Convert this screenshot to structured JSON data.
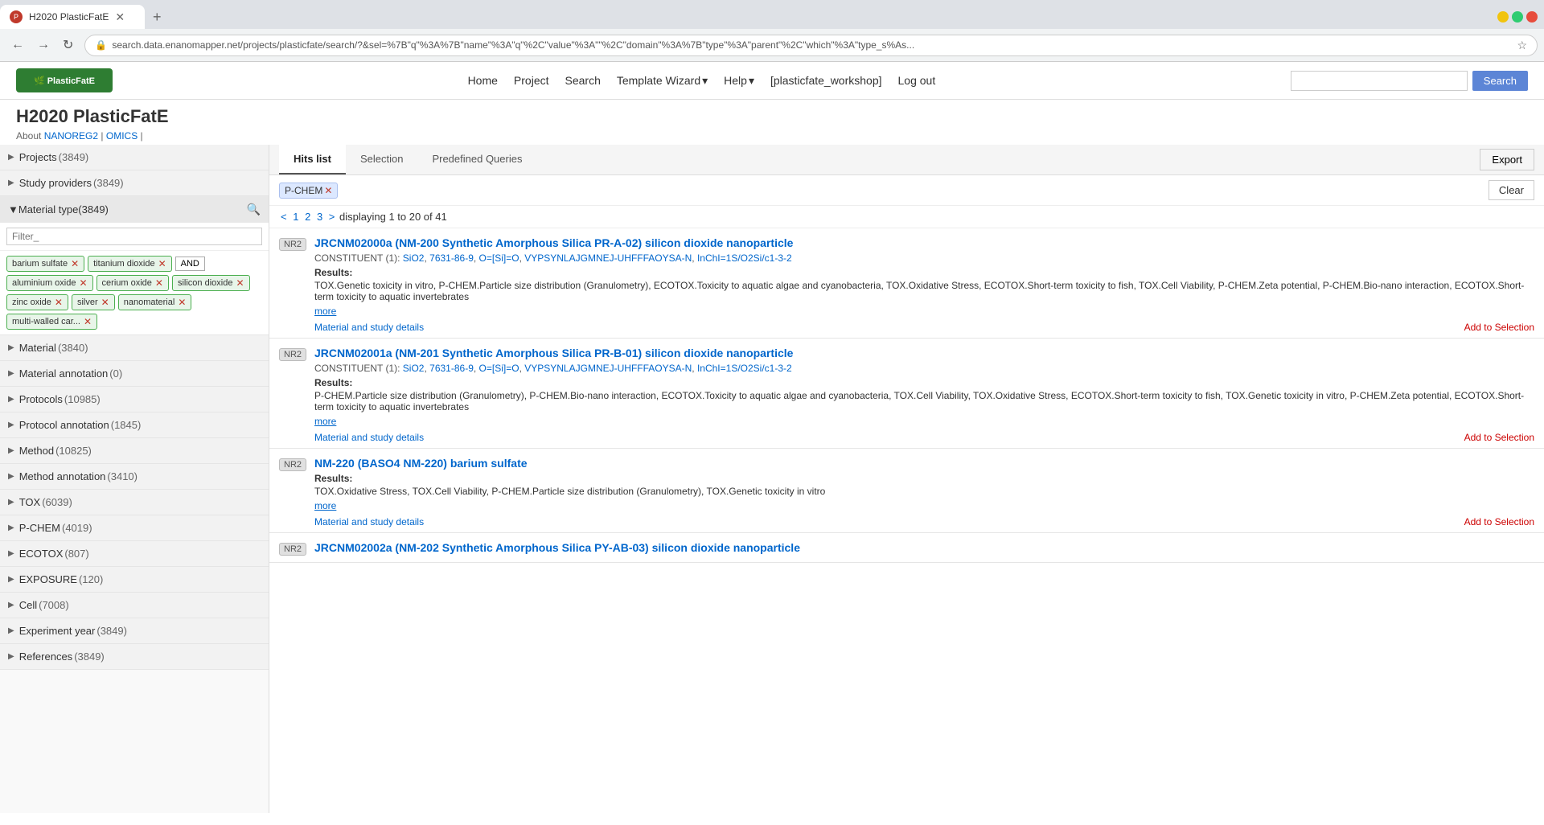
{
  "browser": {
    "tab_title": "H2020 PlasticFatE",
    "url": "search.data.enanomapper.net/projects/plasticfate/search/?&sel=%7B\"q\"%3A%7B\"name\"%3A\"q\"%2C\"value\"%3A\"\"%2C\"domain\"%3A%7B\"type\"%3A\"parent\"%2C\"which\"%3A\"type_s%As...",
    "new_tab": "+",
    "nav_back": "←",
    "nav_forward": "→",
    "nav_refresh": "↻"
  },
  "app": {
    "logo_text": "PlasticFatE",
    "title": "H2020 PlasticFatE",
    "nav": {
      "home": "Home",
      "project": "Project",
      "search": "Search",
      "template_wizard": "Template Wizard",
      "help": "Help",
      "workshop": "[plasticfate_workshop]",
      "logout": "Log out"
    },
    "search_placeholder": "",
    "search_btn": "Search",
    "about_label": "About",
    "nanoreg2": "NANOREG2",
    "omics": "OMICS"
  },
  "tabs": {
    "hits_list": "Hits list",
    "selection": "Selection",
    "predefined_queries": "Predefined Queries",
    "export": "Export"
  },
  "filters": {
    "pchem_tag": "P-CHEM",
    "clear_btn": "Clear"
  },
  "pagination": {
    "text": "< 1 2 3 > displaying 1 to 20 of 41",
    "pages": [
      "1",
      "2",
      "3"
    ]
  },
  "sidebar": {
    "items": [
      {
        "label": "Projects",
        "count": "(3849)",
        "expanded": false
      },
      {
        "label": "Study providers",
        "count": "(3849)",
        "expanded": false
      },
      {
        "label": "Material type",
        "count": "(3849)",
        "expanded": true
      },
      {
        "label": "Material",
        "count": "(3840)",
        "expanded": false
      },
      {
        "label": "Material annotation",
        "count": "(0)",
        "expanded": false
      },
      {
        "label": "Protocols",
        "count": "(10985)",
        "expanded": false
      },
      {
        "label": "Protocol annotation",
        "count": "(1845)",
        "expanded": false
      },
      {
        "label": "Method",
        "count": "(10825)",
        "expanded": false
      },
      {
        "label": "Method annotation",
        "count": "(3410)",
        "expanded": false
      },
      {
        "label": "TOX",
        "count": "(6039)",
        "expanded": false
      },
      {
        "label": "P-CHEM",
        "count": "(4019)",
        "expanded": false
      },
      {
        "label": "ECOTOX",
        "count": "(807)",
        "expanded": false
      },
      {
        "label": "EXPOSURE",
        "count": "(120)",
        "expanded": false
      },
      {
        "label": "Cell",
        "count": "(7008)",
        "expanded": false
      },
      {
        "label": "Experiment year",
        "count": "(3849)",
        "expanded": false
      },
      {
        "label": "References",
        "count": "(3849)",
        "expanded": false
      }
    ],
    "filter_placeholder": "Filter_",
    "tags": [
      "barium sulfate",
      "titanium dioxide",
      "aluminium oxide",
      "cerium oxide",
      "silicon dioxide",
      "zinc oxide",
      "silver",
      "nanomaterial",
      "multi-walled car..."
    ],
    "and_btn": "AND"
  },
  "results": [
    {
      "nr": "NR2",
      "title": "JRCNM02000a (NM-200 Synthetic Amorphous Silica PR-A-02) silicon dioxide nanoparticle",
      "constituent": "CONSTITUENT (1): SiO2, 7631-86-9, O=[Si]=O, VYPSYNLAJGMNEJ-UHFFFAOYSA-N, InChI=1S/O2Si/c1-3-2",
      "results_label": "Results:",
      "results_text": "TOX.Genetic toxicity in vitro, P-CHEM.Particle size distribution (Granulometry), ECOTOX.Toxicity to aquatic algae and cyanobacteria, TOX.Oxidative Stress, ECOTOX.Short-term toxicity to fish, TOX.Cell Viability, P-CHEM.Zeta potential, P-CHEM.Bio-nano interaction, ECOTOX.Short-term toxicity to aquatic invertebrates",
      "more": "more",
      "study_link": "Material and study details",
      "add_selection": "Add to Selection"
    },
    {
      "nr": "NR2",
      "title": "JRCNM02001a (NM-201 Synthetic Amorphous Silica PR-B-01) silicon dioxide nanoparticle",
      "constituent": "CONSTITUENT (1): SiO2, 7631-86-9, O=[Si]=O, VYPSYNLAJGMNEJ-UHFFFAOYSA-N, InChI=1S/O2Si/c1-3-2",
      "results_label": "Results:",
      "results_text": "P-CHEM.Particle size distribution (Granulometry), P-CHEM.Bio-nano interaction, ECOTOX.Toxicity to aquatic algae and cyanobacteria, TOX.Cell Viability, TOX.Oxidative Stress, ECOTOX.Short-term toxicity to fish, TOX.Genetic toxicity in vitro, P-CHEM.Zeta potential, ECOTOX.Short-term toxicity to aquatic invertebrates",
      "more": "more",
      "study_link": "Material and study details",
      "add_selection": "Add to Selection"
    },
    {
      "nr": "NR2",
      "title": "NM-220 (BASO4 NM-220) barium sulfate",
      "constituent": "",
      "results_label": "Results:",
      "results_text": "TOX.Oxidative Stress, TOX.Cell Viability, P-CHEM.Particle size distribution (Granulometry), TOX.Genetic toxicity in vitro",
      "more": "more",
      "study_link": "Material and study details",
      "add_selection": "Add to Selection"
    },
    {
      "nr": "NR2",
      "title": "JRCNM02002a (NM-202 Synthetic Amorphous Silica PY-AB-03) silicon dioxide nanoparticle",
      "constituent": "",
      "results_label": "",
      "results_text": "",
      "more": "",
      "study_link": "",
      "add_selection": ""
    }
  ]
}
